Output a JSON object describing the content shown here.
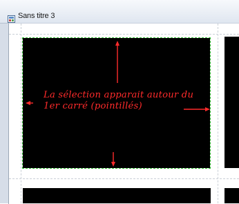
{
  "window": {
    "title": "Sans titre 3"
  },
  "annotation": {
    "text": "La sélection apparait autour du 1er carré (pointillés)"
  },
  "colors": {
    "selection_border": "#36c236",
    "annotation": "#ff2b2b",
    "square_fill": "#000000"
  },
  "icons": {
    "app": "document-app-icon"
  }
}
